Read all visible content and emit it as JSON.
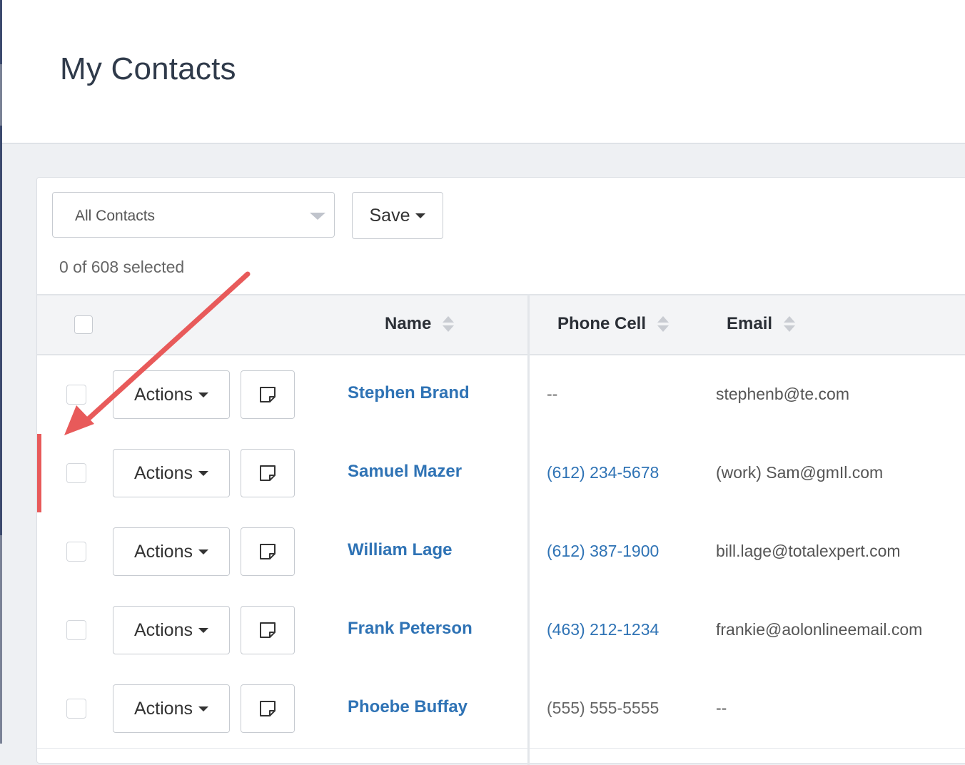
{
  "page": {
    "title": "My Contacts"
  },
  "toolbar": {
    "filter_value": "All Contacts",
    "save_label": "Save",
    "selection_text": "0 of 608 selected"
  },
  "table": {
    "columns": [
      "Name",
      "Phone Cell",
      "Email"
    ],
    "actions_label": "Actions",
    "rows": [
      {
        "name": "Stephen Brand",
        "phone": "--",
        "email": "stephenb@te.com"
      },
      {
        "name": "Samuel Mazer",
        "phone": "(612) 234-5678",
        "email": "(work) Sam@gmIl.com"
      },
      {
        "name": "William Lage",
        "phone": "(612) 387-1900",
        "email": "bill.lage@totalexpert.com"
      },
      {
        "name": "Frank Peterson",
        "phone": "(463) 212-1234",
        "email": "frankie@aolonlineemail.com"
      },
      {
        "name": "Phoebe Buffay",
        "phone": "(555) 555-5555",
        "email": "--"
      }
    ]
  },
  "colors": {
    "link": "#2f73b5",
    "highlight": "#e85a5a",
    "annotation_arrow": "#e85a5a"
  },
  "icons": {
    "note": "sticky-note-icon",
    "caret": "caret-down-icon",
    "sort": "sort-icon"
  }
}
